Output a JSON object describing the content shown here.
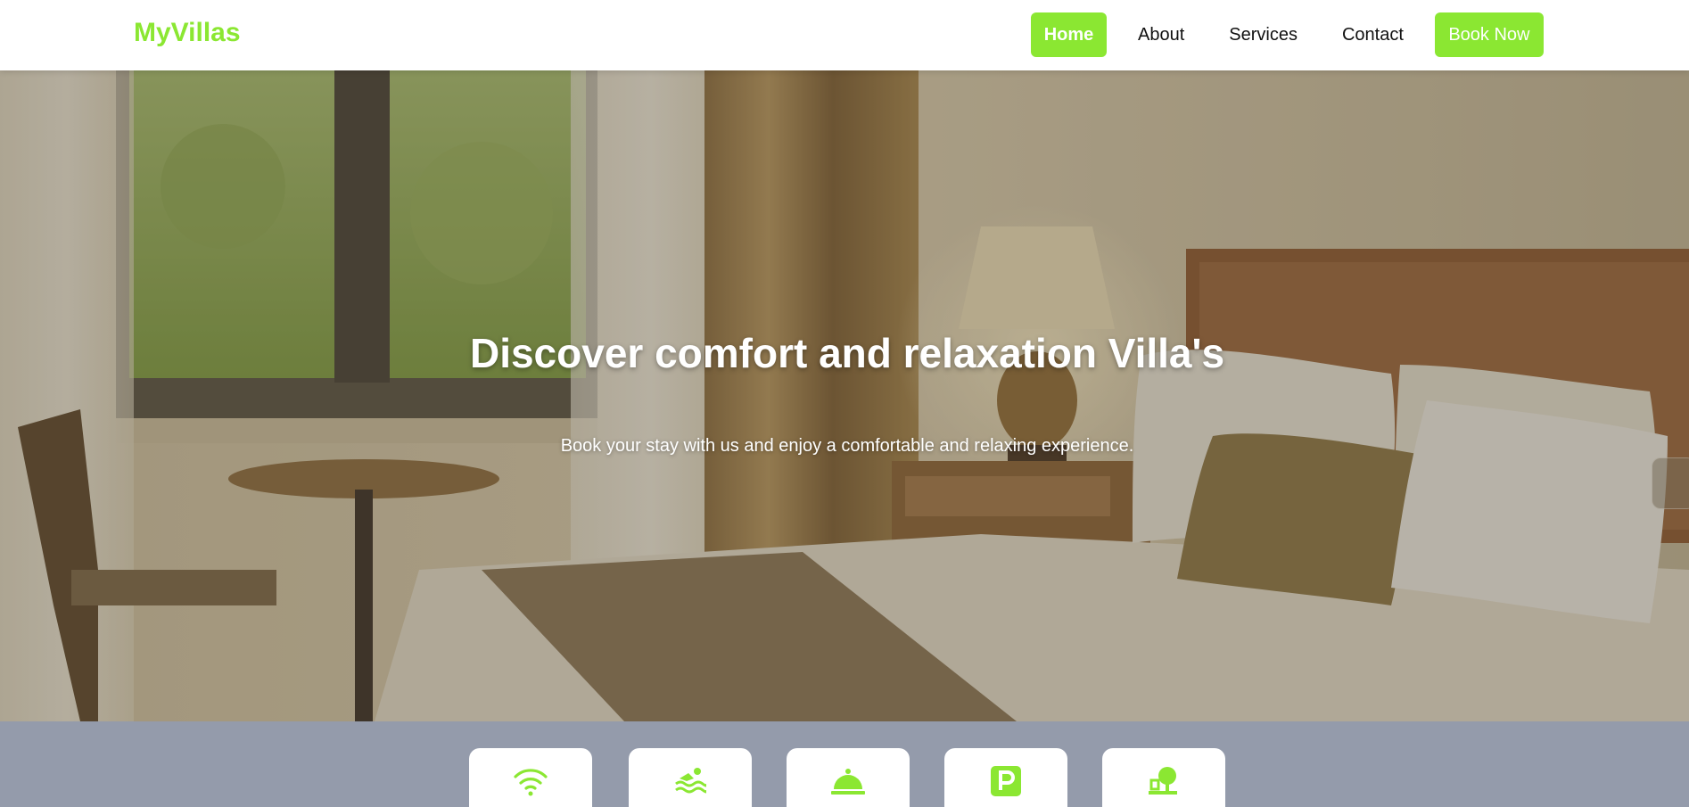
{
  "brand": {
    "name": "MyVillas",
    "accent_color": "#8be732"
  },
  "nav": {
    "home": "Home",
    "about": "About",
    "services": "Services",
    "contact": "Contact",
    "book_now": "Book Now"
  },
  "hero": {
    "title": "Discover comfort and relaxation Villa's",
    "subtitle": "Book your stay with us and enjoy a comfortable and relaxing experience."
  },
  "amenities": {
    "background_color": "#949bab",
    "items": [
      {
        "icon": "wifi-icon"
      },
      {
        "icon": "swimming-pool-icon"
      },
      {
        "icon": "room-service-icon"
      },
      {
        "icon": "parking-icon"
      },
      {
        "icon": "garden-icon"
      }
    ]
  }
}
